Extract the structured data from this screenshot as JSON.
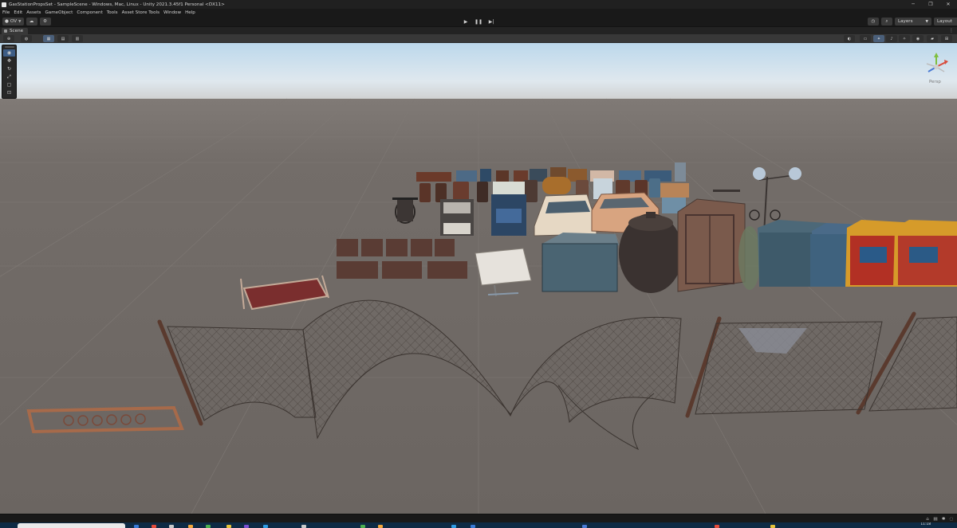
{
  "window": {
    "title": "GasStationPropsSet - SampleScene - Windows, Mac, Linux - Unity 2021.3.45f1 Personal <DX11>",
    "minimize": "─",
    "maximize": "❐",
    "close": "✕"
  },
  "menubar": {
    "items": [
      "File",
      "Edit",
      "Assets",
      "GameObject",
      "Component",
      "Tools",
      "Asset Store Tools",
      "Window",
      "Help"
    ]
  },
  "toolbar": {
    "account_label": "OV",
    "account_icon": "user-icon",
    "cloud_icon": "cloud-icon",
    "collab_icon": "gear-icon",
    "play_icon": "play-icon",
    "pause_icon": "pause-icon",
    "step_icon": "step-icon",
    "history_icon": "history-icon",
    "search_icon": "search-icon",
    "layers_label": "Layers",
    "layout_label": "Layout"
  },
  "scene_tab": {
    "label": "Scene"
  },
  "overlay": {
    "gizmo_label": "Persp"
  },
  "taskbar": {
    "clock": "11:18",
    "colors": [
      "#e34b3b",
      "#c9c9c9",
      "#f3a63b",
      "#3a7ad6",
      "#4cae4f",
      "#7a4fd0",
      "#2f9be3",
      "#e6c23a"
    ]
  },
  "colors": {
    "sky_top": "#b9d6ea",
    "ground": "#6e6864",
    "editor_bg": "#191919",
    "accent": "#3d5d86"
  }
}
